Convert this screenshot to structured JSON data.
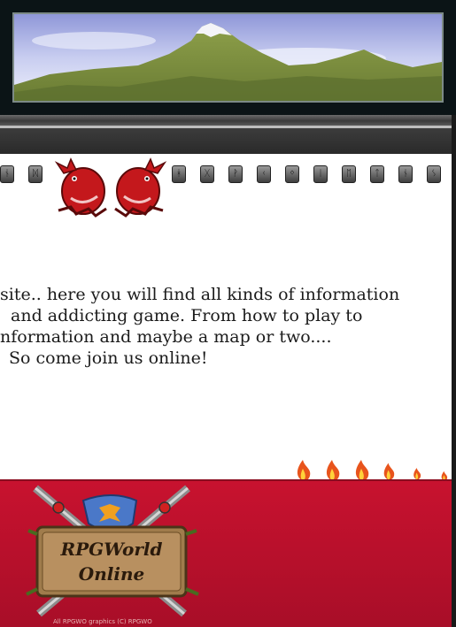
{
  "intro": {
    "lines": [
      "site.. here you will find all kinds of information",
      "and addicting game. From how to play to",
      "nformation and maybe a map or two....",
      "So come join us online!"
    ]
  },
  "logo": {
    "line1": "RPGWorld",
    "line2": "Online"
  },
  "footer": {
    "copyright": "All RPGWO graphics (C) RPGWO"
  },
  "colors": {
    "footer_red": "#b8102c",
    "frame_dark": "#0b1416",
    "dragon_red": "#c4181c"
  },
  "icons": [
    "rune-icon",
    "dragon-icon",
    "flame-icon",
    "crossed-swords-icon",
    "phoenix-shield-icon"
  ]
}
